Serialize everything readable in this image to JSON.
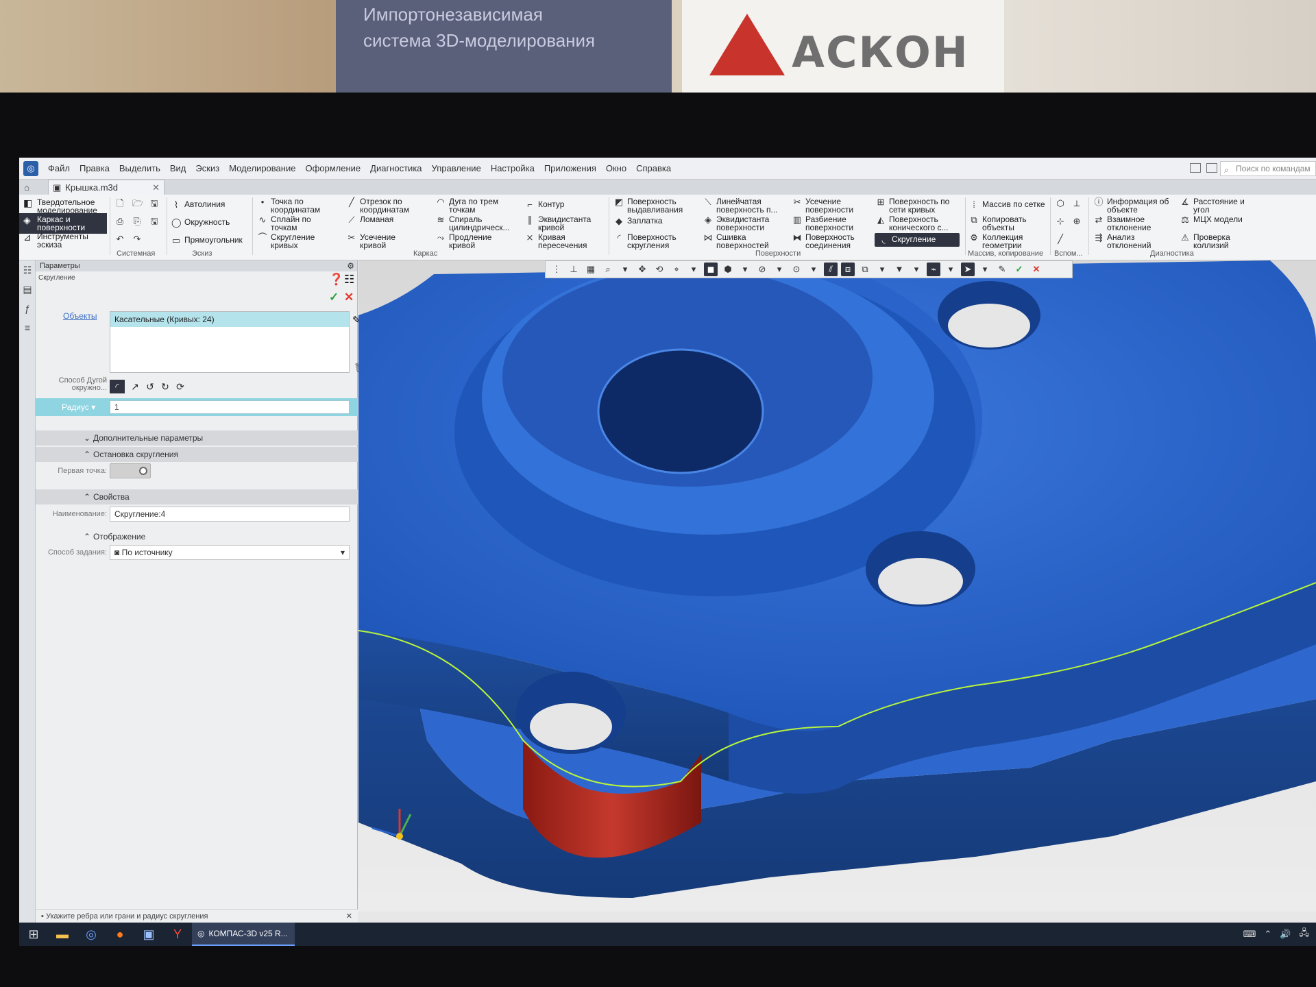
{
  "background": {
    "banner_text_1": "Импортонезависимая",
    "banner_text_2": "система 3D-моделирования",
    "logo_text": "АСКОН"
  },
  "menu": {
    "items": [
      "Файл",
      "Правка",
      "Выделить",
      "Вид",
      "Эскиз",
      "Моделирование",
      "Оформление",
      "Диагностика",
      "Управление",
      "Настройка",
      "Приложения",
      "Окно",
      "Справка"
    ],
    "search_placeholder": "Поиск по командам"
  },
  "tabs": {
    "document": "Крышка.m3d"
  },
  "ribbon": {
    "left_tabs": [
      "Твердотельное моделирование",
      "Каркас и поверхности",
      "Инструменты эскиза"
    ],
    "system_label": "Системная",
    "sketch": {
      "items": [
        "Автолиния",
        "Окружность",
        "Прямоугольник"
      ],
      "label": "Эскиз"
    },
    "frame": {
      "items": [
        "Точка по координатам",
        "Сплайн по точкам",
        "Скругление кривых",
        "Отрезок по координатам",
        "Ломаная",
        "Усечение кривой",
        "Дуга по трем точкам",
        "Спираль цилиндрическ...",
        "Продление кривой",
        "Контур",
        "Эквидистанта кривой",
        "Кривая пересечения"
      ],
      "label": "Каркас"
    },
    "surfaces": {
      "items": [
        "Поверхность выдавливания",
        "Заплатка",
        "Поверхность скругления",
        "Линейчатая поверхность п...",
        "Эквидистанта поверхности",
        "Сшивка поверхностей",
        "Усечение поверхности",
        "Разбиение поверхности",
        "Поверхность соединения",
        "Поверхность по сети кривых",
        "Поверхность конического с...",
        "Скругление"
      ],
      "label": "Поверхности"
    },
    "array": {
      "items": [
        "Массив по сетке",
        "Копировать объекты",
        "Коллекция геометрии"
      ],
      "label": "Массив, копирование"
    },
    "aux_label": "Вспом...",
    "diagnostics": {
      "items": [
        "Информация об объекте",
        "Взаимное отклонение",
        "Анализ отклонений",
        "Расстояние и угол",
        "МЦХ модели",
        "Проверка коллизий"
      ],
      "label": "Диагностика"
    }
  },
  "panel": {
    "title": "Параметры",
    "operation": "Скругление",
    "objects_label": "Объекты",
    "objects_value": "Касательные (Кривых: 24)",
    "method_label": "Способ Дугой окружно...",
    "radius_label": "Радиус",
    "radius_value": "1",
    "sections": {
      "extra": "Дополнительные параметры",
      "stop": "Остановка скругления",
      "props": "Свойства",
      "display": "Отображение"
    },
    "first_point_label": "Первая точка:",
    "name_label": "Наименование:",
    "name_value": "Скругление:4",
    "mode_label": "Способ задания:",
    "mode_value": "По источнику",
    "hint": "Укажите ребра или грани и радиус скругления"
  },
  "taskbar": {
    "app_label": "КОМПАС-3D v25 R..."
  },
  "colors": {
    "model": "#2a63c9",
    "selected_face": "#b0261c",
    "accent": "#8fd4e1"
  }
}
